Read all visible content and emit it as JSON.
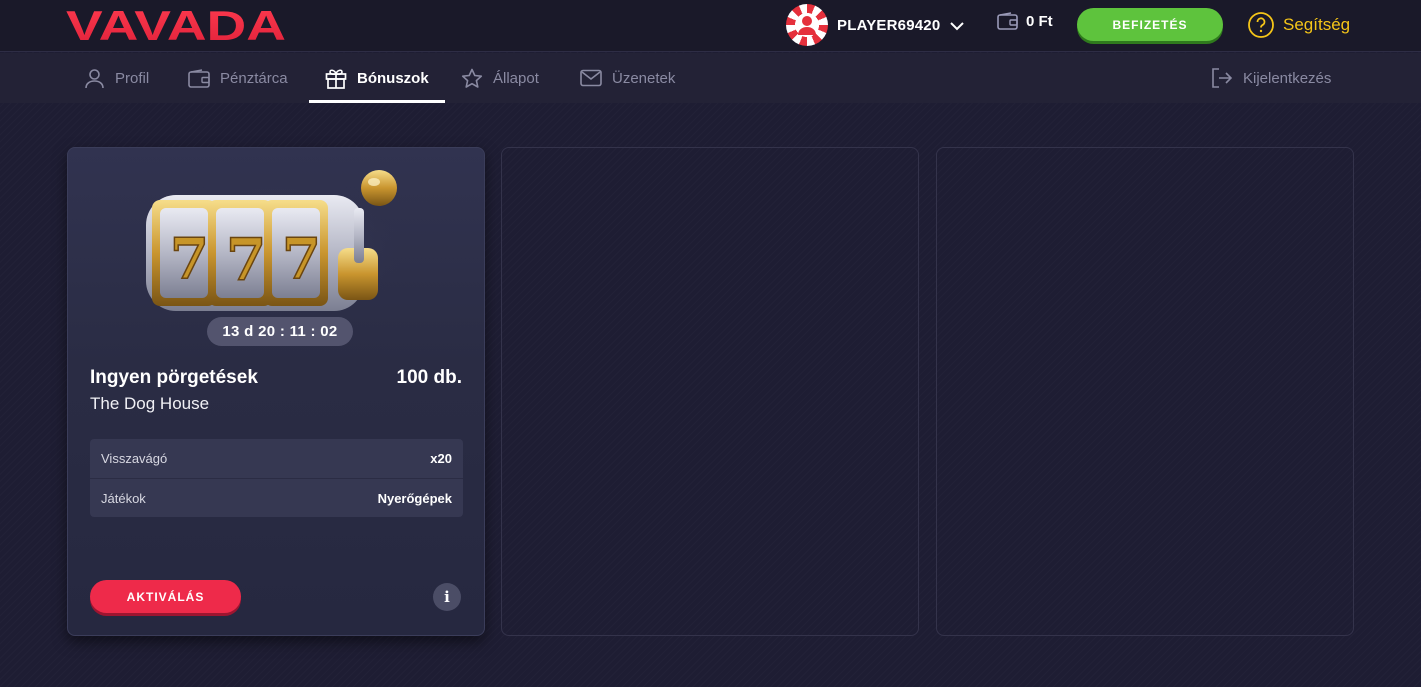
{
  "header": {
    "logo_text": "VAVADA",
    "player_name": "PLAYER69420",
    "balance": "0 Ft",
    "deposit_label": "BEFIZETÉS",
    "help_label": "Segítség"
  },
  "nav": {
    "items": [
      {
        "label": "Profil",
        "icon": "user-icon"
      },
      {
        "label": "Pénztárca",
        "icon": "wallet-icon"
      },
      {
        "label": "Bónuszok",
        "icon": "gift-icon",
        "active": true
      },
      {
        "label": "Állapot",
        "icon": "star-icon"
      },
      {
        "label": "Üzenetek",
        "icon": "mail-icon"
      }
    ],
    "logout_label": "Kijelentkezés"
  },
  "bonus_card": {
    "timer": "13 d 20 : 11 : 02",
    "title": "Ingyen pörgetések",
    "amount": "100 db.",
    "game": "The Dog House",
    "details": [
      {
        "key": "Visszavágó",
        "value": "x20"
      },
      {
        "key": "Játékok",
        "value": "Nyerőgépek"
      }
    ],
    "activate_label": "AKTIVÁLÁS",
    "info_label": "i"
  },
  "colors": {
    "brand_red": "#ee2a4a",
    "deposit_green": "#5ec33d",
    "help_yellow": "#f5c518",
    "background": "#1e1d33"
  }
}
